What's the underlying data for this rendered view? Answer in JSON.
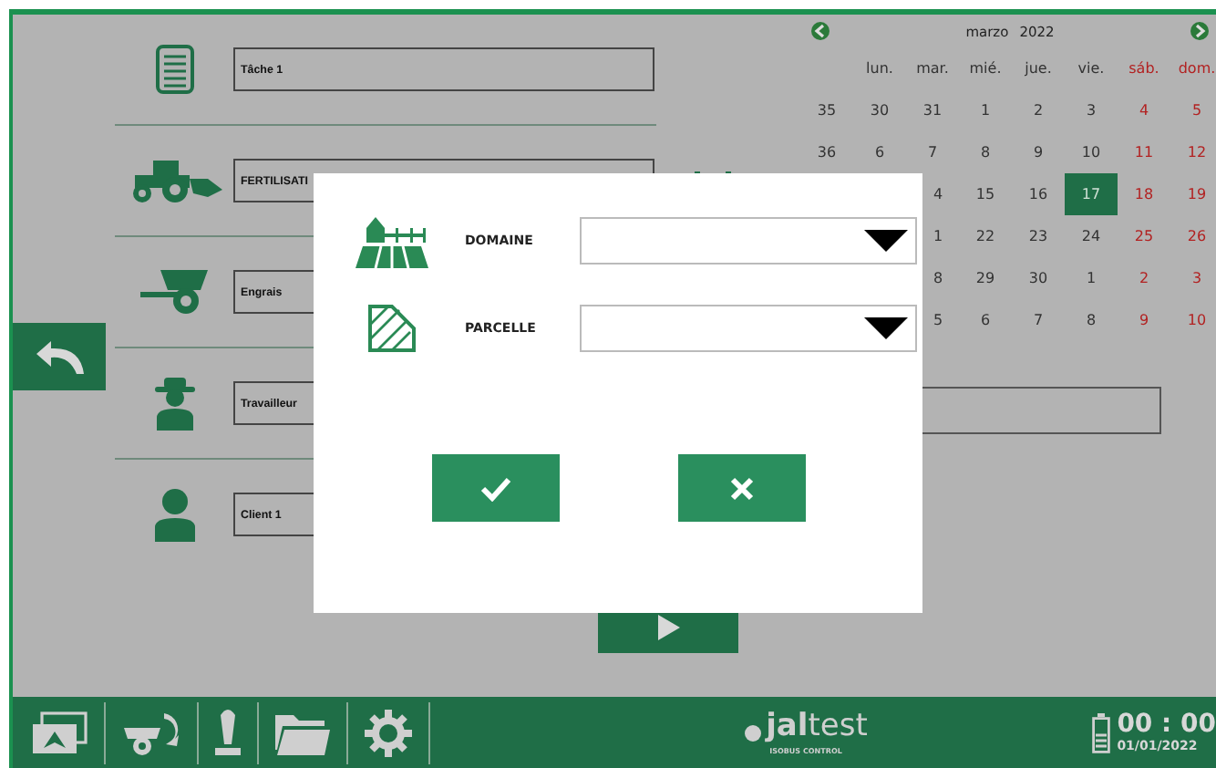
{
  "form": {
    "rows": [
      {
        "kind": "task",
        "value": "Tâche 1"
      },
      {
        "kind": "operation",
        "value": "FERTILISATI"
      },
      {
        "kind": "product",
        "value": "Engrais"
      },
      {
        "kind": "worker",
        "value": "Travailleur"
      },
      {
        "kind": "client",
        "value": "Client  1"
      }
    ]
  },
  "calendar": {
    "month": "marzo",
    "year": "2022",
    "headers": [
      {
        "label": "lun.",
        "weekend": false
      },
      {
        "label": "mar.",
        "weekend": false
      },
      {
        "label": "mié.",
        "weekend": false
      },
      {
        "label": "jue.",
        "weekend": false
      },
      {
        "label": "vie.",
        "weekend": false
      },
      {
        "label": "sáb.",
        "weekend": true
      },
      {
        "label": "dom.",
        "weekend": true
      }
    ],
    "weeks": [
      {
        "week": "35",
        "days": [
          {
            "text": "30",
            "selected": false
          },
          {
            "text": "31",
            "selected": false
          },
          {
            "text": "1",
            "selected": false
          },
          {
            "text": "2",
            "selected": false
          },
          {
            "text": "3",
            "selected": false
          },
          {
            "text": "4",
            "selected": false
          },
          {
            "text": "5",
            "selected": false
          }
        ]
      },
      {
        "week": "36",
        "days": [
          {
            "text": "6",
            "selected": false
          },
          {
            "text": "7",
            "selected": false
          },
          {
            "text": "8",
            "selected": false
          },
          {
            "text": "9",
            "selected": false
          },
          {
            "text": "10",
            "selected": false
          },
          {
            "text": "11",
            "selected": false
          },
          {
            "text": "12",
            "selected": false
          }
        ]
      },
      {
        "days": [
          {
            "text": "4",
            "selected": false
          },
          {
            "text": "15",
            "selected": false
          },
          {
            "text": "16",
            "selected": false
          },
          {
            "text": "17",
            "selected": true
          },
          {
            "text": "18",
            "selected": false
          },
          {
            "text": "19",
            "selected": false
          }
        ]
      },
      {
        "days": [
          {
            "text": "1",
            "selected": false
          },
          {
            "text": "22",
            "selected": false
          },
          {
            "text": "23",
            "selected": false
          },
          {
            "text": "24",
            "selected": false
          },
          {
            "text": "25",
            "selected": false
          },
          {
            "text": "26",
            "selected": false
          }
        ]
      },
      {
        "days": [
          {
            "text": "8",
            "selected": false
          },
          {
            "text": "29",
            "selected": false
          },
          {
            "text": "30",
            "selected": false
          },
          {
            "text": "1",
            "selected": false
          },
          {
            "text": "2",
            "selected": false
          },
          {
            "text": "3",
            "selected": false
          }
        ]
      },
      {
        "days": [
          {
            "text": "5",
            "selected": false
          },
          {
            "text": "6",
            "selected": false
          },
          {
            "text": "7",
            "selected": false
          },
          {
            "text": "8",
            "selected": false
          },
          {
            "text": "9",
            "selected": false
          },
          {
            "text": "10",
            "selected": false
          }
        ]
      }
    ]
  },
  "dialog": {
    "fields": [
      {
        "kind": "farm",
        "label": "DOMAINE"
      },
      {
        "kind": "plot",
        "label": "PARCELLE"
      }
    ]
  },
  "status_bar": {
    "logo": "**jal**test",
    "logo_subtitle": "ISOBUS CONTROL",
    "time": "00 : 00",
    "date": "01/01/2022"
  }
}
